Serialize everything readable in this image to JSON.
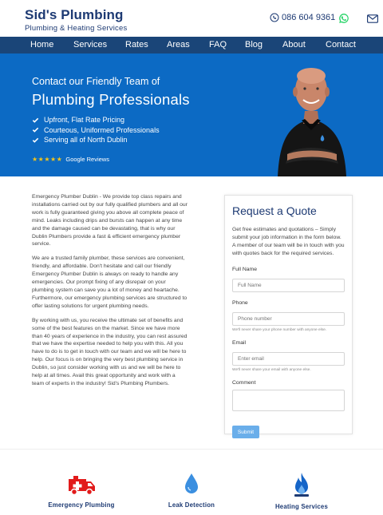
{
  "brand": {
    "title": "Sid's Plumbing",
    "subtitle": "Plumbing & Heating Services",
    "phone": "086 604 9361"
  },
  "nav": [
    "Home",
    "Services",
    "Rates",
    "Areas",
    "FAQ",
    "Blog",
    "About",
    "Contact"
  ],
  "hero": {
    "line1": "Contact our Friendly Team of",
    "line2": "Plumbing Professionals",
    "points": [
      "Upfront, Flat Rate Pricing",
      "Courteous, Uniformed Professionals",
      "Serving all of North Dublin"
    ],
    "stars": "★★★★★",
    "reviews_label": "Google Reviews"
  },
  "content": {
    "p1": "Emergency Plumber Dublin - We provide top class repairs and installations carried out by our fully qualified plumbers and all our work is fully guaranteed giving you above all complete peace of mind. Leaks including drips and bursts can happen at any time and the damage caused can be devastating, that is why our Dublin Plumbers provide a fast & efficient emergency plumber service.",
    "p2": "We are a trusted family plumber, these services are convenient, friendly, and affordable. Don't hesitate and call our friendly Emergency Plumber Dublin is always on ready to handle any emergencies. Our prompt fixing of any disrepair on your plumbing system can save you a lot of money and heartache. Furthermore, our emergency plumbing services are structured to offer lasting solutions for urgent plumbing needs.",
    "p3": "By working with us, you receive the ultimate set of benefits and some of the best features on the market. Since we have more than 40 years of experience in the industry, you can rest assured that we have the expertise needed to help you with this. All you have to do is to get in touch with our team and we will be here to help. Our focus is on bringing the very best plumbing service in Dublin, so just consider working with us and we will be here to help at all times. Avail this great opportunity and work with a team of experts in the industry! Sid's Plumbing Plumbers."
  },
  "form": {
    "title": "Request a Quote",
    "description": "Get free estimates and quotations – Simply submit your job information in the form below. A member of our team will be in touch with you with quotes back for the required services.",
    "name_label": "Full Name",
    "name_placeholder": "Full Name",
    "phone_label": "Phone",
    "phone_placeholder": "Phone number",
    "phone_help": "We'll never share your phone number with anyone else.",
    "email_label": "Email",
    "email_placeholder": "Enter email",
    "email_help": "We'll never share your email with anyone else.",
    "comment_label": "Comment",
    "submit_label": "Submit"
  },
  "services": [
    {
      "label": "Emergency Plumbing",
      "icon": "ambulance-icon"
    },
    {
      "label": "Leak Detection",
      "icon": "water-drop-icon"
    },
    {
      "label": "Heating Services",
      "icon": "flame-icon"
    }
  ],
  "colors": {
    "brand_navy": "#1d3a73",
    "nav_bg": "#1a4578",
    "hero_bg": "#0c6ac4",
    "whatsapp": "#25d366",
    "star": "#f5c518",
    "emergency_red": "#e21b1b",
    "water_blue": "#3b8fe0",
    "submit": "#6aaeea"
  }
}
